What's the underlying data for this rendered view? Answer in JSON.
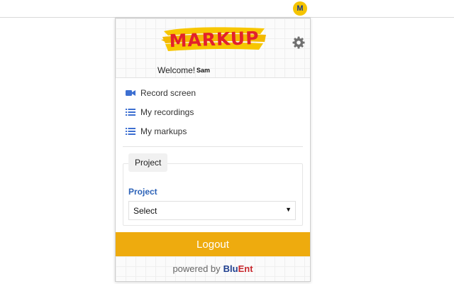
{
  "browser": {
    "extension_icon_letter": "M",
    "extension_icon_color": "#f5c400"
  },
  "header": {
    "logo_text": "MARKUP",
    "logo_color": "#e2202c",
    "logo_brush_color": "#f7c600",
    "settings_icon": "gear-icon"
  },
  "welcome": {
    "greeting": "Welcome!",
    "user_name": "Sam"
  },
  "menu": {
    "items": [
      {
        "label": "Record screen",
        "icon": "video-camera-icon"
      },
      {
        "label": "My recordings",
        "icon": "list-icon"
      },
      {
        "label": "My markups",
        "icon": "list-icon"
      }
    ],
    "icon_color": "#3d6fd1"
  },
  "project": {
    "legend": "Project",
    "label": "Project",
    "select_value": "Select",
    "label_color": "#2d63b8"
  },
  "logout": {
    "label": "Logout",
    "color": "#eeab0e"
  },
  "footer": {
    "powered_by": "powered by",
    "brand_part1": "Blu",
    "brand_part2": "Ent"
  }
}
